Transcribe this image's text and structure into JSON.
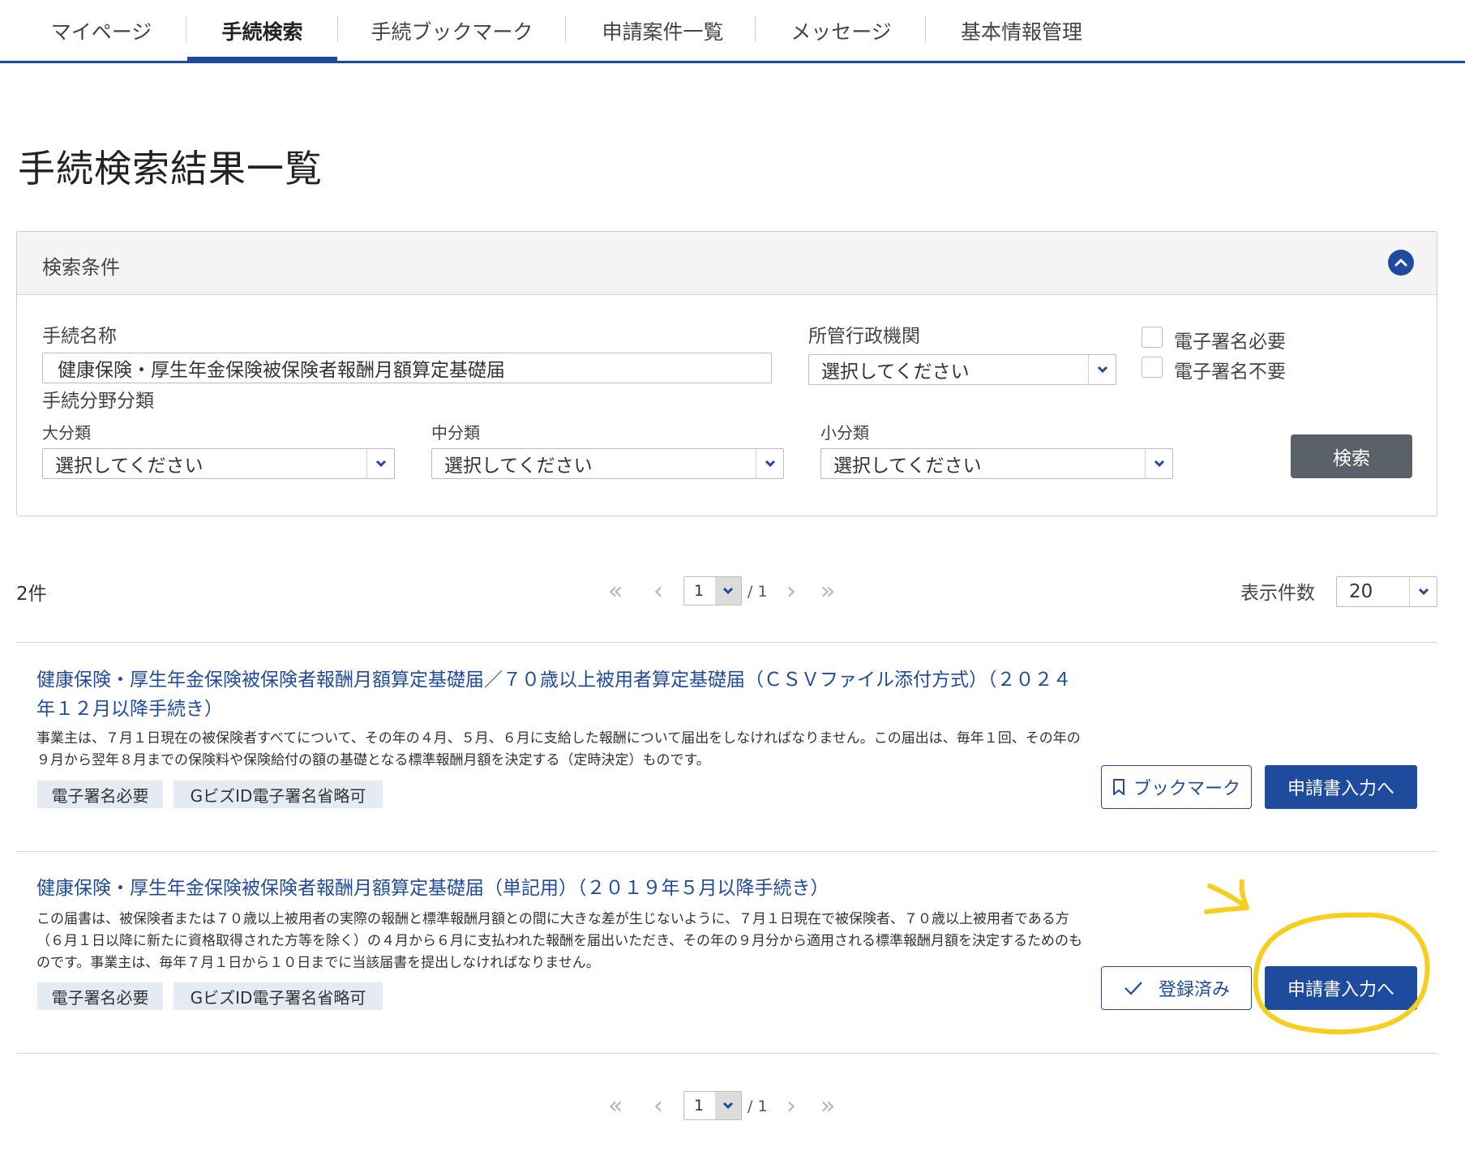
{
  "nav": {
    "tabs": [
      {
        "label": "マイページ"
      },
      {
        "label": "手続検索"
      },
      {
        "label": "手続ブックマーク"
      },
      {
        "label": "申請案件一覧"
      },
      {
        "label": "メッセージ"
      },
      {
        "label": "基本情報管理"
      }
    ],
    "active_index": 1
  },
  "page_title": "手続検索結果一覧",
  "search_panel": {
    "title": "検索条件",
    "procedure_name_label": "手続名称",
    "procedure_name_value": "健康保険・厚生年金保険被保険者報酬月額算定基礎届",
    "agency_label": "所管行政機関",
    "agency_value": "選択してください",
    "esign_required_label": "電子署名必要",
    "esign_not_required_label": "電子署名不要",
    "category_label": "手続分野分類",
    "large_label": "大分類",
    "large_value": "選択してください",
    "middle_label": "中分類",
    "middle_value": "選択してください",
    "small_label": "小分類",
    "small_value": "選択してください",
    "search_button": "検索"
  },
  "results_count": "2件",
  "pager": {
    "current": "1",
    "total": "/ 1"
  },
  "per_page": {
    "label": "表示件数",
    "value": "20"
  },
  "results": [
    {
      "title": "健康保険・厚生年金保険被保険者報酬月額算定基礎届／７０歳以上被用者算定基礎届（ＣＳＶファイル添付方式）（２０２４年１２月以降手続き）",
      "description": "事業主は、７月１日現在の被保険者すべてについて、その年の４月、５月、６月に支給した報酬について届出をしなければなりません。この届出は、毎年１回、その年の９月から翌年８月までの保険料や保険給付の額の基礎となる標準報酬月額を決定する（定時決定）ものです。",
      "tags": [
        "電子署名必要",
        "GビズID電子署名省略可"
      ],
      "bookmark_label": "ブックマーク",
      "apply_label": "申請書入力へ"
    },
    {
      "title": "健康保険・厚生年金保険被保険者報酬月額算定基礎届（単記用）（２０１９年５月以降手続き）",
      "description": "この届書は、被保険者または７０歳以上被用者の実際の報酬と標準報酬月額との間に大きな差が生じないように、７月１日現在で被保険者、７０歳以上被用者である方（６月１日以降に新たに資格取得された方等を除く）の４月から６月に支払われた報酬を届出いただき、その年の９月分から適用される標準報酬月額を決定するためのものです。事業主は、毎年７月１日から１０日までに当該届書を提出しなければなりません。",
      "tags": [
        "電子署名必要",
        "GビズID電子署名省略可"
      ],
      "bookmark_label": "登録済み",
      "apply_label": "申請書入力へ"
    }
  ],
  "colors": {
    "accent": "#1f4b9e",
    "annotation": "#f6cf1e"
  },
  "icons": [
    "chevron-up-icon",
    "chevron-down-icon",
    "bookmark-icon",
    "check-icon",
    "first-page-icon",
    "prev-page-icon",
    "next-page-icon",
    "last-page-icon"
  ]
}
